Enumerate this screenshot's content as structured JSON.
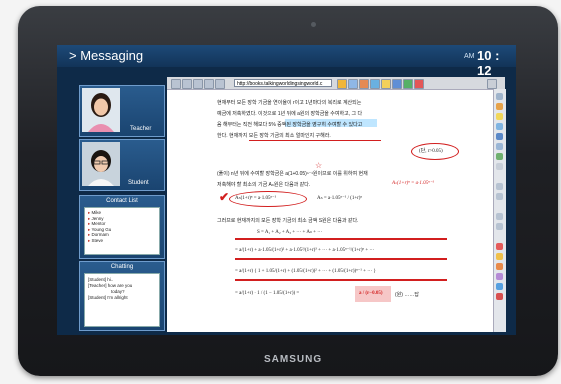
{
  "app": {
    "title": "> Messaging",
    "clock_ampm": "AM",
    "clock_time": "10 : 12",
    "brand": "SAMSUNG"
  },
  "video": {
    "teacher_label": "Teacher",
    "student_label": "Student"
  },
  "contacts": {
    "title": "Contact  List",
    "items": [
      "Mike",
      "Jenny",
      "Mentor",
      "Young Gu",
      "Dormam",
      "Steve"
    ]
  },
  "chat": {
    "title": "Chatting",
    "lines": [
      "[Student] hi..",
      "[Teacher] how are you",
      "today?",
      "[Student] I'm allright"
    ]
  },
  "browser": {
    "url": "http://books.talkingworldingsingworld.c"
  },
  "document": {
    "lines": [
      "현재부터 모든 장학 기금을 연이율이 r이고 1년마다의 복리로 계산되는",
      "예금에 저축하였다. 이것으로 1년 뒤에 a원의 장학금을 수여하고, 그 다",
      "음 해부터는 직전 해보다 5% 증액된 장학금을 영구히 수여할 수 있다고",
      "한다. 현재까지 모든 장학 기금의 최소 얼마인지 구해라."
    ],
    "condition": "(단, r>0.05)",
    "sol_1": "(풀이) n년 뒤에 수여할 장학금은 a(1+0.05)ⁿ⁻¹원이므로 이를 위하여 현재",
    "sol_2": "저축해야 할 최소의 기금 Aₙ원은 다음과 같다.",
    "formula_left": "Aₙ(1+r)ⁿ = a·1.05ⁿ⁻¹",
    "formula_right": "Aₙ = a·1.05ⁿ⁻¹ / (1+r)ⁿ",
    "handwritten_note": "Aₙ(1+r)ⁿ = a·1.05ⁿ⁻¹",
    "sol_3": "그러므로 현재까지의 모든 장학 기금의 최소 금액 S원은 다음과 같다.",
    "sum_line": "S = A₁ + A₂ + A₃ + ··· + Aₙ + ···",
    "eq1": "= a/(1+r) + a·1.05/(1+r)² + a·1.05²/(1+r)³ + ··· + a·1.05ⁿ⁻¹/(1+r)ⁿ + ···",
    "eq2": "= a/(1+r) { 1 + 1.05/(1+r) + (1.05/(1+r))² + ··· + (1.05/(1+r))ⁿ⁻¹ + ··· }",
    "eq3_prefix": "= a/(1+r) · 1 / (1 − 1.05/(1+r)) =",
    "eq3_boxed": "a / (r−0.05)",
    "eq3_suffix": "(원)  ……답"
  },
  "colors": {
    "accent": "#d21f1f",
    "highlight": "#bfe6ff",
    "screen_bg": "#0e2a48"
  }
}
